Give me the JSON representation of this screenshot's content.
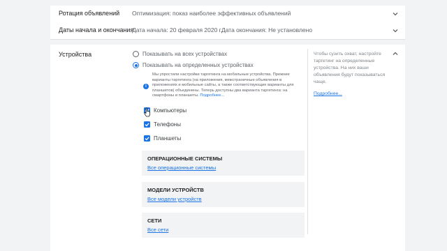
{
  "rows": {
    "rotation": {
      "label": "Ротация объявлений",
      "value": "Оптимизация: показ наиболее эффективных объявлений"
    },
    "dates": {
      "label": "Даты начала и окончания",
      "start": "Дата начала: 20 февраля 2020 г.",
      "end": "Дата окончания: Не установлено"
    }
  },
  "devices": {
    "title": "Устройства",
    "option_all": "Показывать на всех устройствах",
    "option_specific": "Показывать на определенных устройствах",
    "selected_option": "option_specific",
    "info_text": "Мы упростили настройки таргетинга на мобильные устройства. Прежние варианты таргетинга (на приложения, межстраничные объявления в приложениях и мобильные сайты, а также соответствующие варианты для планшетов) объединены. Теперь доступны два варианта таргетинга: на смартфоны и планшеты.",
    "info_link": "Подробнее...",
    "checkboxes": [
      {
        "label": "Компьютеры",
        "checked": true
      },
      {
        "label": "Телефоны",
        "checked": true
      },
      {
        "label": "Планшеты",
        "checked": true
      }
    ],
    "sections": [
      {
        "title": "ОПЕРАЦИОННЫЕ СИСТЕМЫ",
        "link": "Все операционные системы"
      },
      {
        "title": "МОДЕЛИ УСТРОЙСТВ",
        "link": "Все модели устройств"
      },
      {
        "title": "СЕТИ",
        "link": "Все сети"
      }
    ],
    "help_text": "Чтобы сузить охват, настройте таргетинг на определенные устройства. На них ваши объявления будут показываться чаще.",
    "help_link": "Подробнее..."
  },
  "icons": {
    "row_expand": "chevron-down-icon",
    "section_collapse": "chevron-up-icon",
    "info": "info-icon",
    "checkbox": "check-icon",
    "pointer": "hand-cursor-icon"
  },
  "colors": {
    "accent": "#1a73e8",
    "background": "#f1f3f4",
    "panel": "#ffffff"
  }
}
